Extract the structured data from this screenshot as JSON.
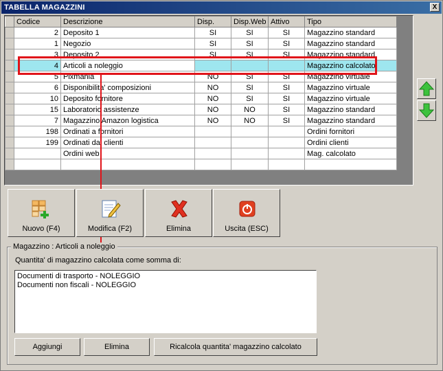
{
  "window": {
    "title": "TABELLA MAGAZZINI",
    "close_label": "X"
  },
  "grid": {
    "headers": [
      "Codice",
      "Descrizione",
      "Disp.",
      "Disp.Web",
      "Attivo",
      "Tipo"
    ],
    "rows": [
      [
        "2",
        "Deposito 1",
        "SI",
        "SI",
        "SI",
        "Magazzino standard"
      ],
      [
        "1",
        "Negozio",
        "SI",
        "SI",
        "SI",
        "Magazzino standard"
      ],
      [
        "3",
        "Deposito 2",
        "SI",
        "SI",
        "SI",
        "Magazzino standard"
      ],
      [
        "4",
        "Articoli a noleggio",
        "",
        "",
        "",
        "Magazzino calcolato"
      ],
      [
        "5",
        "Pixmania",
        "NO",
        "SI",
        "SI",
        "Magazzino virtuale"
      ],
      [
        "6",
        "Disponibilita' composizioni",
        "NO",
        "SI",
        "SI",
        "Magazzino virtuale"
      ],
      [
        "10",
        "Deposito fornitore",
        "NO",
        "SI",
        "SI",
        "Magazzino virtuale"
      ],
      [
        "15",
        "Laboratorio assistenze",
        "NO",
        "NO",
        "SI",
        "Magazzino standard"
      ],
      [
        "7",
        "Magazzino Amazon logistica",
        "NO",
        "NO",
        "SI",
        "Magazzino standard"
      ],
      [
        "198",
        "Ordinati a fornitori",
        "",
        "",
        "",
        "Ordini fornitori"
      ],
      [
        "199",
        "Ordinati dai clienti",
        "",
        "",
        "",
        "Ordini clienti"
      ],
      [
        "",
        "Ordini web",
        "",
        "",
        "",
        "Mag. calcolato"
      ],
      [
        "",
        "",
        "",
        "",
        "",
        ""
      ]
    ],
    "selected_row": 3
  },
  "toolbar": {
    "new_label": "Nuovo (F4)",
    "edit_label": "Modifica (F2)",
    "delete_label": "Elimina",
    "exit_label": "Uscita (ESC)"
  },
  "detail": {
    "group_label": "Magazzino : Articoli a noleggio",
    "description": "Quantita' di magazzino calcolata come somma di:",
    "items": [
      "Documenti di trasporto - NOLEGGIO",
      "Documenti non fiscali - NOLEGGIO"
    ],
    "add_label": "Aggiungi",
    "delete_label": "Elimina",
    "recalc_label": "Ricalcola quantita' magazzino calcolato"
  },
  "colors": {
    "selected_row": "#9ee6ef",
    "highlight": "#e0141a",
    "title_bar": "#0a246a"
  }
}
